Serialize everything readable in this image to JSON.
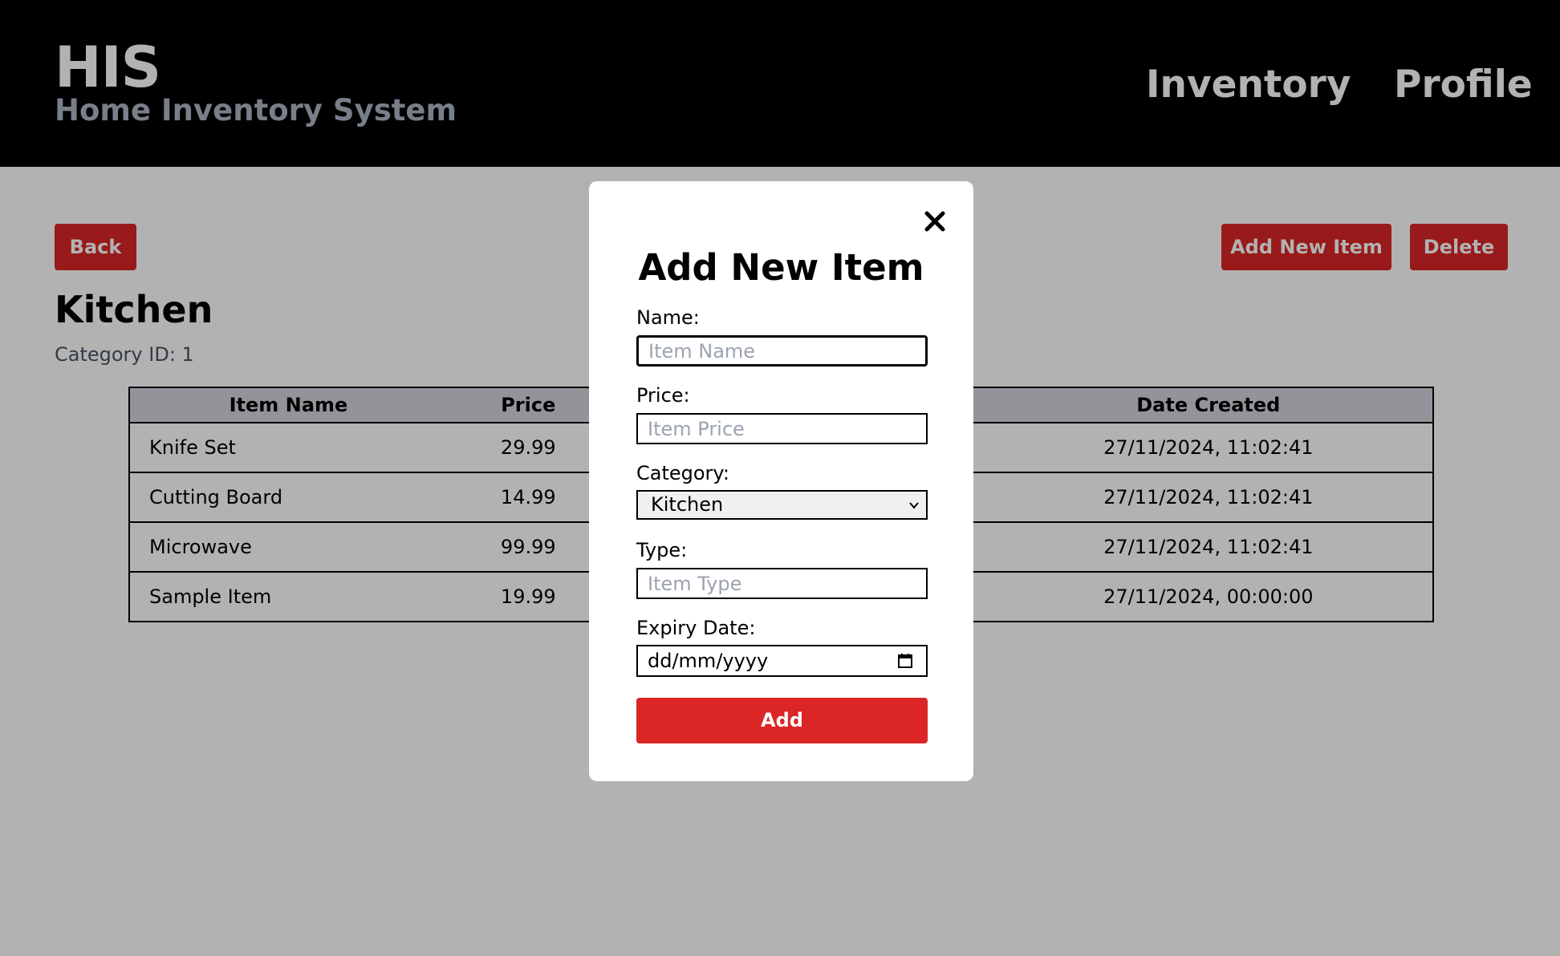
{
  "header": {
    "title": "HIS",
    "subtitle": "Home Inventory System",
    "nav": {
      "inventory": "Inventory",
      "profile": "Profile"
    }
  },
  "toolbar": {
    "back_label": "Back",
    "add_new_label": "Add New Item",
    "delete_label": "Delete"
  },
  "category": {
    "name": "Kitchen",
    "id_text": "Category ID: 1"
  },
  "table": {
    "headers": {
      "name": "Item Name",
      "price": "Price",
      "date": "Date Created"
    },
    "rows": [
      {
        "name": "Knife Set",
        "price": "29.99",
        "date": "27/11/2024, 11:02:41"
      },
      {
        "name": "Cutting Board",
        "price": "14.99",
        "date": "27/11/2024, 11:02:41"
      },
      {
        "name": "Microwave",
        "price": "99.99",
        "date": "27/11/2024, 11:02:41"
      },
      {
        "name": "Sample Item",
        "price": "19.99",
        "date": "27/11/2024, 00:00:00"
      }
    ]
  },
  "modal": {
    "title": "Add New Item",
    "name_label": "Name:",
    "name_placeholder": "Item Name",
    "price_label": "Price:",
    "price_placeholder": "Item Price",
    "category_label": "Category:",
    "category_selected": "Kitchen",
    "type_label": "Type:",
    "type_placeholder": "Item Type",
    "expiry_label": "Expiry Date:",
    "expiry_placeholder": "dd/mm/yyyy",
    "add_label": "Add"
  },
  "colors": {
    "header_bg": "#000000",
    "accent_red": "#dc2626",
    "overlay": "rgba(0,0,0,0.30)"
  },
  "icons": [
    "close-icon",
    "chevron-down-icon",
    "calendar-icon"
  ]
}
